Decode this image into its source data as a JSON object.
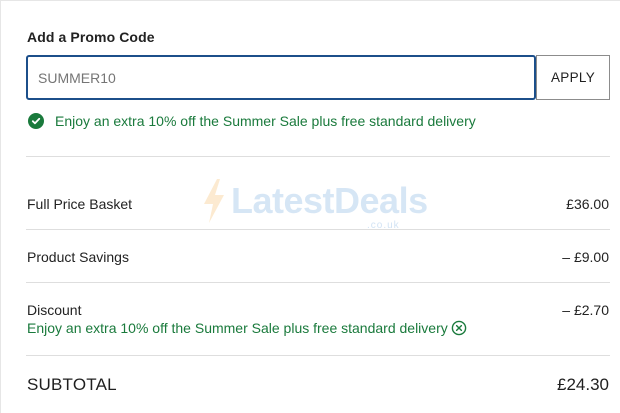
{
  "promo": {
    "title": "Add a Promo Code",
    "input_value": "SUMMER10",
    "apply_label": "APPLY",
    "success_message": "Enjoy an extra 10% off the Summer Sale plus free standard delivery",
    "success_icon": "check-circle-icon"
  },
  "summary": {
    "full_price_label": "Full Price Basket",
    "full_price_value": "£36.00",
    "savings_label": "Product Savings",
    "savings_value": "– £9.00",
    "discount_label": "Discount",
    "discount_value": "– £2.70",
    "discount_note": "Enjoy an extra 10% off the Summer Sale plus free standard delivery",
    "remove_icon": "remove-circle-icon",
    "subtotal_label": "SUBTOTAL",
    "subtotal_value": "£24.30"
  },
  "watermark": {
    "text": "LatestDeals",
    "sub": ".co.uk"
  },
  "colors": {
    "success_green": "#1a7a3c",
    "input_border": "#1c4f8a",
    "watermark_blue": "#4b8fd4"
  }
}
